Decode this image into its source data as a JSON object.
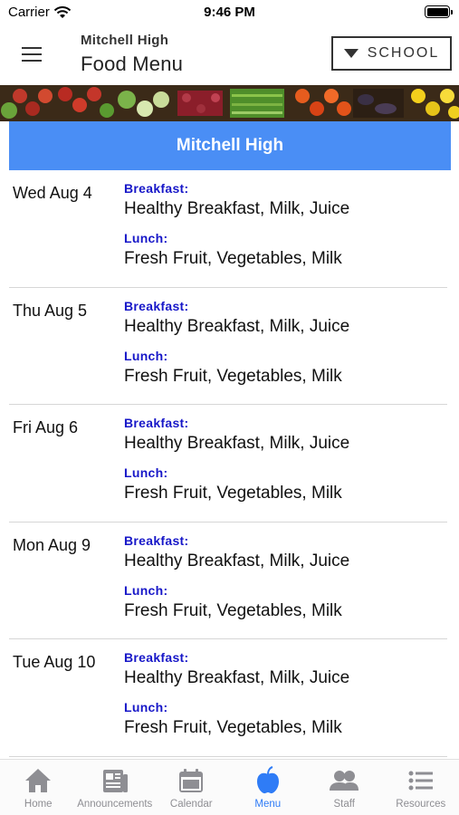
{
  "status_bar": {
    "carrier": "Carrier",
    "time": "9:46 PM"
  },
  "nav": {
    "subtitle": "Mitchell High",
    "title": "Food Menu",
    "school_button": "SCHOOL"
  },
  "header": {
    "school_name": "Mitchell High"
  },
  "menu": {
    "days": [
      {
        "date": "Wed Aug 4",
        "breakfast_label": "Breakfast:",
        "breakfast": "Healthy Breakfast, Milk, Juice",
        "lunch_label": "Lunch:",
        "lunch": "Fresh Fruit, Vegetables, Milk"
      },
      {
        "date": "Thu Aug 5",
        "breakfast_label": "Breakfast:",
        "breakfast": "Healthy Breakfast, Milk, Juice",
        "lunch_label": "Lunch:",
        "lunch": "Fresh Fruit, Vegetables, Milk"
      },
      {
        "date": "Fri Aug 6",
        "breakfast_label": "Breakfast:",
        "breakfast": "Healthy Breakfast, Milk, Juice",
        "lunch_label": "Lunch:",
        "lunch": "Fresh Fruit, Vegetables, Milk"
      },
      {
        "date": "Mon Aug 9",
        "breakfast_label": "Breakfast:",
        "breakfast": "Healthy Breakfast, Milk, Juice",
        "lunch_label": "Lunch:",
        "lunch": "Fresh Fruit, Vegetables, Milk"
      },
      {
        "date": "Tue Aug 10",
        "breakfast_label": "Breakfast:",
        "breakfast": "Healthy Breakfast, Milk, Juice",
        "lunch_label": "Lunch:",
        "lunch": "Fresh Fruit, Vegetables, Milk"
      }
    ]
  },
  "tab_bar": {
    "tabs": [
      {
        "label": "Home",
        "icon": "home-icon",
        "active": false
      },
      {
        "label": "Announcements",
        "icon": "newspaper-icon",
        "active": false
      },
      {
        "label": "Calendar",
        "icon": "calendar-icon",
        "active": false
      },
      {
        "label": "Menu",
        "icon": "apple-icon",
        "active": true
      },
      {
        "label": "Staff",
        "icon": "people-icon",
        "active": false
      },
      {
        "label": "Resources",
        "icon": "list-icon",
        "active": false
      }
    ]
  },
  "colors": {
    "header_blue": "#4a8ef5",
    "meal_label_blue": "#1717c8",
    "tab_active": "#2f7cf6",
    "tab_inactive": "#8e8e93"
  }
}
